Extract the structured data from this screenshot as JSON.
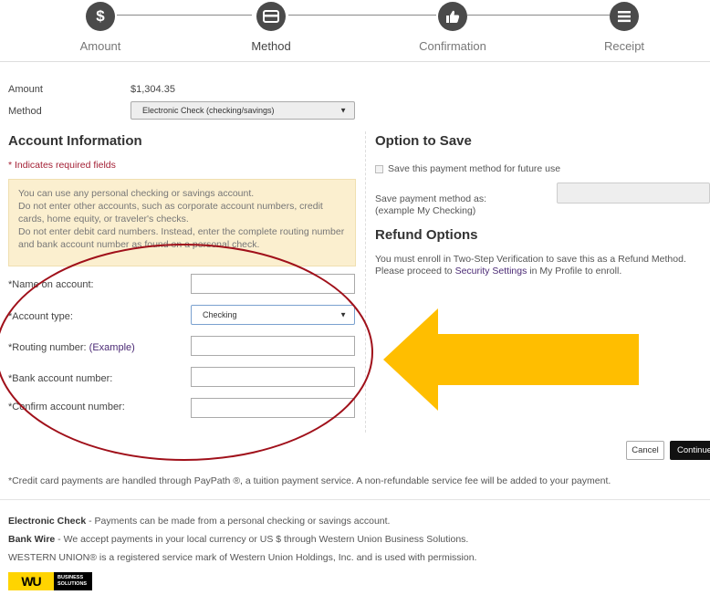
{
  "steps": [
    {
      "label": "Amount",
      "icon": "dollar-icon",
      "glyph": "$"
    },
    {
      "label": "Method",
      "icon": "credit-card-icon",
      "glyph": ""
    },
    {
      "label": "Confirmation",
      "icon": "thumbs-up-icon",
      "glyph": ""
    },
    {
      "label": "Receipt",
      "icon": "list-icon",
      "glyph": ""
    }
  ],
  "summary": {
    "amount_label": "Amount",
    "amount_value": "$1,304.35",
    "method_label": "Method",
    "method_selected": "Electronic Check (checking/savings)"
  },
  "account": {
    "heading": "Account Information",
    "required_note": "* Indicates required fields",
    "notice_lines": [
      "You can use any personal checking or savings account.",
      "Do not enter other accounts, such as corporate account numbers, credit cards, home equity, or traveler's checks.",
      "Do not enter debit card numbers. Instead, enter the complete routing number and bank account number as found on a personal check."
    ],
    "fields": {
      "name_label": "*Name on account:",
      "type_label": "*Account type:",
      "type_selected": "Checking",
      "routing_label": "*Routing number: ",
      "routing_link": "(Example)",
      "bank_label": "*Bank account number:",
      "confirm_label": "*Confirm account number:"
    }
  },
  "save": {
    "heading": "Option to Save",
    "checkbox_label": "Save this payment method for future use",
    "save_as_label": "Save payment method as:",
    "save_as_hint": "(example My Checking)"
  },
  "refund": {
    "heading": "Refund Options",
    "text_before": "You must enroll in Two-Step Verification to save this as a Refund Method. Please proceed to ",
    "link": "Security Settings",
    "text_after": " in My Profile to enroll."
  },
  "buttons": {
    "cancel": "Cancel",
    "continue": "Continue"
  },
  "footnote": "*Credit card payments are handled through PayPath ®, a tuition payment service. A non-refundable service fee will be added to your payment.",
  "footer": {
    "echeck_title": "Electronic Check",
    "echeck_text": " - Payments can be made from a personal checking or savings  account.",
    "wire_title": "Bank Wire",
    "wire_text": " - We accept payments in your local currency or US $ through Western Union Business Solutions.",
    "wu_text": "WESTERN UNION® is a registered service mark of Western Union Holdings, Inc. and is used with permission.",
    "logo_mark": "WU",
    "logo_text_1": "BUSINESS",
    "logo_text_2": "SOLUTIONS"
  },
  "colors": {
    "arrow": "#ffbe00",
    "ellipse": "#a0101a",
    "required": "#a31f34",
    "link": "#4b2a75"
  }
}
